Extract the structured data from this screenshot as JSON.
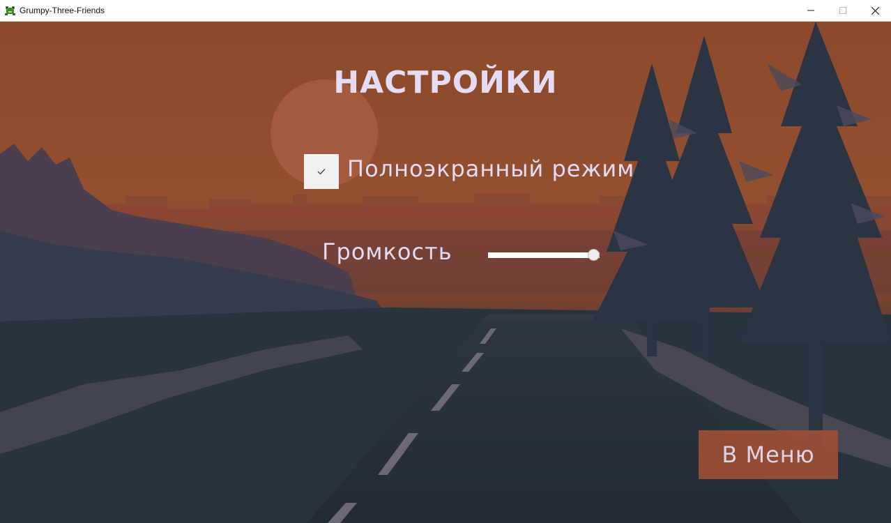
{
  "window": {
    "title": "Grumpy-Three-Friends",
    "controls": [
      "minimize",
      "maximize",
      "close"
    ]
  },
  "settings": {
    "heading": "НАСТРОЙКИ",
    "fullscreen": {
      "label": "Полноэкранный режим",
      "checked": true
    },
    "volume": {
      "label": "Громкость",
      "value": 1.0
    },
    "menu_button": "В Меню"
  },
  "colors": {
    "text": "#e4dcf4",
    "button_bg": "#9c4f36",
    "sky": "#8a4a2c",
    "ground": "#2a3340"
  },
  "icons": [
    "frog-app-icon",
    "minimize-icon",
    "maximize-icon",
    "close-icon",
    "check-icon"
  ]
}
